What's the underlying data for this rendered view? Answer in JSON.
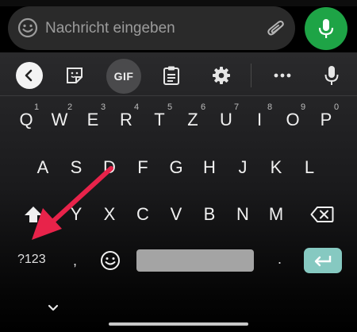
{
  "message": {
    "placeholder": "Nachricht eingeben"
  },
  "toolbar": {
    "gif_label": "GIF",
    "items": [
      "back-icon",
      "sticker-icon",
      "gif",
      "clipboard-icon",
      "settings-gear-icon",
      "more-dots-icon",
      "voice-mic-icon"
    ]
  },
  "keyboard": {
    "row1": [
      {
        "key": "Q",
        "hint": "1"
      },
      {
        "key": "W",
        "hint": "2"
      },
      {
        "key": "E",
        "hint": "3"
      },
      {
        "key": "R",
        "hint": "4"
      },
      {
        "key": "T",
        "hint": "5"
      },
      {
        "key": "Z",
        "hint": "6"
      },
      {
        "key": "U",
        "hint": "7"
      },
      {
        "key": "I",
        "hint": "8"
      },
      {
        "key": "O",
        "hint": "9"
      },
      {
        "key": "P",
        "hint": "0"
      }
    ],
    "row2": [
      "A",
      "S",
      "D",
      "F",
      "G",
      "H",
      "J",
      "K",
      "L"
    ],
    "row3": [
      "Y",
      "X",
      "C",
      "V",
      "B",
      "N",
      "M"
    ],
    "symbols_label": "?123",
    "comma": ",",
    "period": "."
  },
  "colors": {
    "send_button": "#1ea446",
    "enter_key": "#86c9c1",
    "annotation_arrow": "#e8234a"
  }
}
